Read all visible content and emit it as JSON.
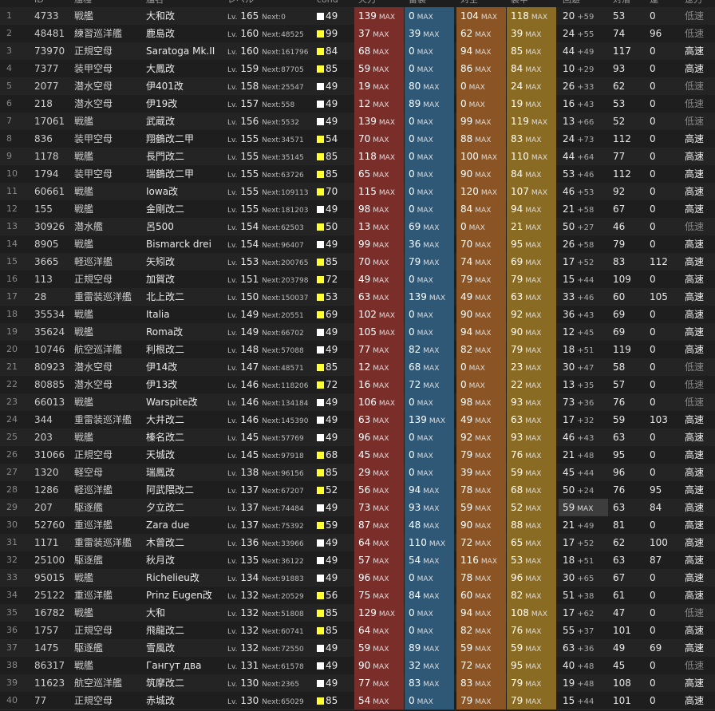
{
  "table": {
    "columns": [
      "ID",
      "艦種",
      "艦名",
      "レベル",
      "cond",
      "火力",
      "雷装",
      "対空",
      "装甲",
      "回避",
      "対潜",
      "索敵",
      "運",
      "速力"
    ],
    "max_label": "MAX",
    "lv_prefix": "Lv.",
    "next_prefix": "Next:",
    "colors": {
      "cond_white": "#ffffff",
      "cond_yellow": "#ffff33",
      "firepower": "#7a2e2a",
      "torpedo": "#2f5877",
      "antiair": "#8a5424",
      "armor": "#8a6b24"
    },
    "rows": [
      {
        "n": "1",
        "id": "4733",
        "type": "戦艦",
        "name": "大和改",
        "lv": "165",
        "next": "0",
        "cond": "49",
        "cc": "w",
        "fp": "139",
        "tp": "0",
        "aa": "104",
        "ar": "118",
        "ev": "20",
        "evp": "+59",
        "asw": "53",
        "luck": "0",
        "spd": "低速"
      },
      {
        "n": "2",
        "id": "48481",
        "type": "練習巡洋艦",
        "name": "鹿島改",
        "lv": "160",
        "next": "48525",
        "cond": "99",
        "cc": "y",
        "fp": "37",
        "tp": "39",
        "aa": "62",
        "ar": "39",
        "ev": "24",
        "evp": "+55",
        "asw": "74",
        "luck": "96",
        "spd": "低速"
      },
      {
        "n": "3",
        "id": "73970",
        "type": "正規空母",
        "name": "Saratoga Mk.II",
        "lv": "160",
        "next": "161796",
        "cond": "84",
        "cc": "y",
        "fp": "68",
        "tp": "0",
        "aa": "94",
        "ar": "85",
        "ev": "44",
        "evp": "+49",
        "asw": "117",
        "luck": "0",
        "spd": "高速"
      },
      {
        "n": "4",
        "id": "7377",
        "type": "装甲空母",
        "name": "大鳳改",
        "lv": "159",
        "next": "87705",
        "cond": "85",
        "cc": "y",
        "fp": "59",
        "tp": "0",
        "aa": "86",
        "ar": "84",
        "ev": "10",
        "evp": "+29",
        "asw": "93",
        "luck": "0",
        "spd": "高速"
      },
      {
        "n": "5",
        "id": "2077",
        "type": "潜水空母",
        "name": "伊401改",
        "lv": "158",
        "next": "25547",
        "cond": "49",
        "cc": "w",
        "fp": "19",
        "tp": "80",
        "aa": "0",
        "ar": "24",
        "ev": "26",
        "evp": "+33",
        "asw": "62",
        "luck": "0",
        "spd": "低速"
      },
      {
        "n": "6",
        "id": "218",
        "type": "潜水空母",
        "name": "伊19改",
        "lv": "157",
        "next": "558",
        "cond": "49",
        "cc": "w",
        "fp": "12",
        "tp": "89",
        "aa": "0",
        "ar": "19",
        "ev": "16",
        "evp": "+43",
        "asw": "53",
        "luck": "0",
        "spd": "低速"
      },
      {
        "n": "7",
        "id": "17061",
        "type": "戦艦",
        "name": "武蔵改",
        "lv": "156",
        "next": "5532",
        "cond": "49",
        "cc": "w",
        "fp": "139",
        "tp": "0",
        "aa": "99",
        "ar": "119",
        "ev": "13",
        "evp": "+66",
        "asw": "52",
        "luck": "0",
        "spd": "低速"
      },
      {
        "n": "8",
        "id": "836",
        "type": "装甲空母",
        "name": "翔鶴改二甲",
        "lv": "155",
        "next": "34571",
        "cond": "54",
        "cc": "y",
        "fp": "70",
        "tp": "0",
        "aa": "88",
        "ar": "83",
        "ev": "24",
        "evp": "+73",
        "asw": "112",
        "luck": "0",
        "spd": "高速"
      },
      {
        "n": "9",
        "id": "1178",
        "type": "戦艦",
        "name": "長門改二",
        "lv": "155",
        "next": "35145",
        "cond": "85",
        "cc": "y",
        "fp": "118",
        "tp": "0",
        "aa": "100",
        "ar": "110",
        "ev": "44",
        "evp": "+64",
        "asw": "77",
        "luck": "0",
        "spd": "高速"
      },
      {
        "n": "10",
        "id": "1794",
        "type": "装甲空母",
        "name": "瑞鶴改二甲",
        "lv": "155",
        "next": "63726",
        "cond": "85",
        "cc": "y",
        "fp": "65",
        "tp": "0",
        "aa": "90",
        "ar": "84",
        "ev": "53",
        "evp": "+46",
        "asw": "112",
        "luck": "0",
        "spd": "高速"
      },
      {
        "n": "11",
        "id": "60661",
        "type": "戦艦",
        "name": "Iowa改",
        "lv": "155",
        "next": "109113",
        "cond": "70",
        "cc": "y",
        "fp": "115",
        "tp": "0",
        "aa": "120",
        "ar": "107",
        "ev": "46",
        "evp": "+53",
        "asw": "92",
        "luck": "0",
        "spd": "高速"
      },
      {
        "n": "12",
        "id": "155",
        "type": "戦艦",
        "name": "金剛改二",
        "lv": "155",
        "next": "181203",
        "cond": "49",
        "cc": "w",
        "fp": "98",
        "tp": "0",
        "aa": "84",
        "ar": "94",
        "ev": "21",
        "evp": "+58",
        "asw": "67",
        "luck": "0",
        "spd": "高速"
      },
      {
        "n": "13",
        "id": "30926",
        "type": "潜水艦",
        "name": "呂500",
        "lv": "154",
        "next": "62503",
        "cond": "50",
        "cc": "y",
        "fp": "13",
        "tp": "69",
        "aa": "0",
        "ar": "21",
        "ev": "50",
        "evp": "+27",
        "asw": "46",
        "luck": "0",
        "spd": "低速"
      },
      {
        "n": "14",
        "id": "8905",
        "type": "戦艦",
        "name": "Bismarck drei",
        "lv": "154",
        "next": "96407",
        "cond": "49",
        "cc": "w",
        "fp": "99",
        "tp": "36",
        "aa": "70",
        "ar": "95",
        "ev": "26",
        "evp": "+58",
        "asw": "79",
        "luck": "0",
        "spd": "高速"
      },
      {
        "n": "15",
        "id": "3665",
        "type": "軽巡洋艦",
        "name": "矢矧改",
        "lv": "153",
        "next": "200765",
        "cond": "85",
        "cc": "y",
        "fp": "70",
        "tp": "79",
        "aa": "74",
        "ar": "69",
        "ev": "17",
        "evp": "+52",
        "asw": "83",
        "luck": "112",
        "spd": "高速"
      },
      {
        "n": "16",
        "id": "113",
        "type": "正規空母",
        "name": "加賀改",
        "lv": "151",
        "next": "203798",
        "cond": "72",
        "cc": "y",
        "fp": "49",
        "tp": "0",
        "aa": "79",
        "ar": "79",
        "ev": "15",
        "evp": "+44",
        "asw": "109",
        "luck": "0",
        "spd": "高速"
      },
      {
        "n": "17",
        "id": "28",
        "type": "重雷装巡洋艦",
        "name": "北上改二",
        "lv": "150",
        "next": "150037",
        "cond": "53",
        "cc": "y",
        "fp": "63",
        "tp": "139",
        "aa": "49",
        "ar": "63",
        "ev": "33",
        "evp": "+46",
        "asw": "60",
        "luck": "105",
        "spd": "高速"
      },
      {
        "n": "18",
        "id": "35534",
        "type": "戦艦",
        "name": "Italia",
        "lv": "149",
        "next": "20551",
        "cond": "69",
        "cc": "y",
        "fp": "102",
        "tp": "0",
        "aa": "90",
        "ar": "92",
        "ev": "36",
        "evp": "+43",
        "asw": "69",
        "luck": "0",
        "spd": "高速"
      },
      {
        "n": "19",
        "id": "35624",
        "type": "戦艦",
        "name": "Roma改",
        "lv": "149",
        "next": "66702",
        "cond": "49",
        "cc": "w",
        "fp": "105",
        "tp": "0",
        "aa": "94",
        "ar": "90",
        "ev": "12",
        "evp": "+45",
        "asw": "69",
        "luck": "0",
        "spd": "高速"
      },
      {
        "n": "20",
        "id": "10746",
        "type": "航空巡洋艦",
        "name": "利根改二",
        "lv": "148",
        "next": "57088",
        "cond": "49",
        "cc": "w",
        "fp": "77",
        "tp": "82",
        "aa": "82",
        "ar": "79",
        "ev": "18",
        "evp": "+51",
        "asw": "119",
        "luck": "0",
        "spd": "高速"
      },
      {
        "n": "21",
        "id": "80923",
        "type": "潜水空母",
        "name": "伊14改",
        "lv": "147",
        "next": "48571",
        "cond": "85",
        "cc": "y",
        "fp": "12",
        "tp": "68",
        "aa": "0",
        "ar": "23",
        "ev": "30",
        "evp": "+47",
        "asw": "58",
        "luck": "0",
        "spd": "低速"
      },
      {
        "n": "22",
        "id": "80885",
        "type": "潜水空母",
        "name": "伊13改",
        "lv": "146",
        "next": "118206",
        "cond": "72",
        "cc": "y",
        "fp": "16",
        "tp": "72",
        "aa": "0",
        "ar": "22",
        "ev": "13",
        "evp": "+35",
        "asw": "57",
        "luck": "0",
        "spd": "低速"
      },
      {
        "n": "23",
        "id": "66013",
        "type": "戦艦",
        "name": "Warspite改",
        "lv": "146",
        "next": "134184",
        "cond": "49",
        "cc": "w",
        "fp": "106",
        "tp": "0",
        "aa": "98",
        "ar": "93",
        "ev": "73",
        "evp": "+36",
        "asw": "76",
        "luck": "0",
        "spd": "低速"
      },
      {
        "n": "24",
        "id": "344",
        "type": "重雷装巡洋艦",
        "name": "大井改二",
        "lv": "146",
        "next": "145390",
        "cond": "49",
        "cc": "w",
        "fp": "63",
        "tp": "139",
        "aa": "49",
        "ar": "63",
        "ev": "17",
        "evp": "+32",
        "asw": "59",
        "luck": "103",
        "spd": "高速"
      },
      {
        "n": "25",
        "id": "203",
        "type": "戦艦",
        "name": "榛名改二",
        "lv": "145",
        "next": "57769",
        "cond": "49",
        "cc": "w",
        "fp": "96",
        "tp": "0",
        "aa": "92",
        "ar": "93",
        "ev": "46",
        "evp": "+43",
        "asw": "63",
        "luck": "0",
        "spd": "高速"
      },
      {
        "n": "26",
        "id": "31066",
        "type": "正規空母",
        "name": "天城改",
        "lv": "145",
        "next": "97918",
        "cond": "68",
        "cc": "y",
        "fp": "45",
        "tp": "0",
        "aa": "79",
        "ar": "76",
        "ev": "21",
        "evp": "+48",
        "asw": "95",
        "luck": "0",
        "spd": "高速"
      },
      {
        "n": "27",
        "id": "1320",
        "type": "軽空母",
        "name": "瑞鳳改",
        "lv": "138",
        "next": "96156",
        "cond": "85",
        "cc": "y",
        "fp": "29",
        "tp": "0",
        "aa": "39",
        "ar": "59",
        "ev": "45",
        "evp": "+44",
        "asw": "96",
        "luck": "0",
        "spd": "高速"
      },
      {
        "n": "28",
        "id": "1286",
        "type": "軽巡洋艦",
        "name": "阿武隈改二",
        "lv": "137",
        "next": "67207",
        "cond": "52",
        "cc": "y",
        "fp": "56",
        "tp": "94",
        "aa": "78",
        "ar": "68",
        "ev": "50",
        "evp": "+24",
        "asw": "76",
        "luck": "95",
        "spd": "高速"
      },
      {
        "n": "29",
        "id": "207",
        "type": "駆逐艦",
        "name": "夕立改二",
        "lv": "137",
        "next": "74484",
        "cond": "49",
        "cc": "w",
        "fp": "73",
        "tp": "93",
        "aa": "59",
        "ar": "52",
        "ev": "59",
        "evp": "",
        "asw": "63",
        "luck": "84",
        "spd": "高速"
      },
      {
        "n": "30",
        "id": "52760",
        "type": "重巡洋艦",
        "name": "Zara due",
        "lv": "137",
        "next": "75392",
        "cond": "59",
        "cc": "y",
        "fp": "87",
        "tp": "48",
        "aa": "90",
        "ar": "88",
        "ev": "21",
        "evp": "+49",
        "asw": "81",
        "luck": "0",
        "spd": "高速"
      },
      {
        "n": "31",
        "id": "1171",
        "type": "重雷装巡洋艦",
        "name": "木曾改二",
        "lv": "136",
        "next": "33966",
        "cond": "49",
        "cc": "w",
        "fp": "64",
        "tp": "110",
        "aa": "72",
        "ar": "65",
        "ev": "17",
        "evp": "+52",
        "asw": "62",
        "luck": "100",
        "spd": "高速"
      },
      {
        "n": "32",
        "id": "25100",
        "type": "駆逐艦",
        "name": "秋月改",
        "lv": "135",
        "next": "36122",
        "cond": "49",
        "cc": "w",
        "fp": "57",
        "tp": "54",
        "aa": "116",
        "ar": "53",
        "ev": "18",
        "evp": "+51",
        "asw": "63",
        "luck": "87",
        "spd": "高速"
      },
      {
        "n": "33",
        "id": "95015",
        "type": "戦艦",
        "name": "Richelieu改",
        "lv": "134",
        "next": "91883",
        "cond": "49",
        "cc": "w",
        "fp": "96",
        "tp": "0",
        "aa": "78",
        "ar": "96",
        "ev": "30",
        "evp": "+65",
        "asw": "67",
        "luck": "0",
        "spd": "高速"
      },
      {
        "n": "34",
        "id": "25122",
        "type": "重巡洋艦",
        "name": "Prinz Eugen改",
        "lv": "132",
        "next": "20529",
        "cond": "56",
        "cc": "y",
        "fp": "75",
        "tp": "84",
        "aa": "60",
        "ar": "82",
        "ev": "51",
        "evp": "+38",
        "asw": "61",
        "luck": "0",
        "spd": "高速"
      },
      {
        "n": "35",
        "id": "16782",
        "type": "戦艦",
        "name": "大和",
        "lv": "132",
        "next": "51808",
        "cond": "85",
        "cc": "y",
        "fp": "129",
        "tp": "0",
        "aa": "94",
        "ar": "108",
        "ev": "17",
        "evp": "+62",
        "asw": "47",
        "luck": "0",
        "spd": "低速"
      },
      {
        "n": "36",
        "id": "1757",
        "type": "正規空母",
        "name": "飛龍改二",
        "lv": "132",
        "next": "60741",
        "cond": "85",
        "cc": "y",
        "fp": "64",
        "tp": "0",
        "aa": "82",
        "ar": "76",
        "ev": "55",
        "evp": "+37",
        "asw": "101",
        "luck": "0",
        "spd": "高速"
      },
      {
        "n": "37",
        "id": "1475",
        "type": "駆逐艦",
        "name": "雪風改",
        "lv": "132",
        "next": "72550",
        "cond": "49",
        "cc": "w",
        "fp": "59",
        "tp": "89",
        "aa": "59",
        "ar": "59",
        "ev": "63",
        "evp": "+36",
        "asw": "49",
        "luck": "69",
        "spd": "高速"
      },
      {
        "n": "38",
        "id": "86317",
        "type": "戦艦",
        "name": "Гангут два",
        "lv": "131",
        "next": "61578",
        "cond": "49",
        "cc": "w",
        "fp": "90",
        "tp": "32",
        "aa": "72",
        "ar": "95",
        "ev": "40",
        "evp": "+48",
        "asw": "45",
        "luck": "0",
        "spd": "低速"
      },
      {
        "n": "39",
        "id": "11623",
        "type": "航空巡洋艦",
        "name": "筑摩改二",
        "lv": "130",
        "next": "2365",
        "cond": "49",
        "cc": "w",
        "fp": "77",
        "tp": "83",
        "aa": "83",
        "ar": "79",
        "ev": "19",
        "evp": "+48",
        "asw": "108",
        "luck": "0",
        "spd": "高速"
      },
      {
        "n": "40",
        "id": "77",
        "type": "正規空母",
        "name": "赤城改",
        "lv": "130",
        "next": "65029",
        "cond": "85",
        "cc": "y",
        "fp": "54",
        "tp": "0",
        "aa": "79",
        "ar": "79",
        "ev": "15",
        "evp": "+44",
        "asw": "101",
        "luck": "0",
        "spd": "高速"
      }
    ]
  }
}
